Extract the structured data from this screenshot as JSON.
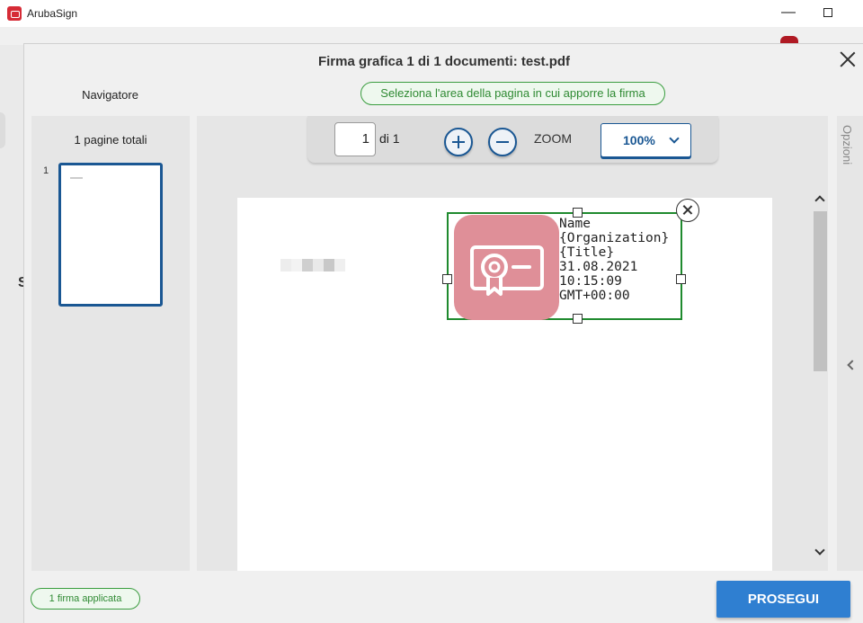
{
  "app": {
    "title": "ArubaSign"
  },
  "dialog": {
    "title": "Firma grafica 1 di 1 documenti: test.pdf",
    "hint": "Seleziona l'area della pagina in cui apporre la firma"
  },
  "navigator": {
    "title": "Navigatore",
    "total_pages": "1 pagine totali",
    "thumbnails": [
      {
        "number": "1"
      }
    ]
  },
  "toolbar": {
    "page_value": "1",
    "page_of": "di 1",
    "zoom_label": "ZOOM",
    "zoom_value": "100%"
  },
  "signature": {
    "text": "Name\n{Organization}\n{Title}\n31.08.2021\n10:15:09\nGMT+00:00",
    "icon_bg": "#df8f98",
    "border_color": "#1f8a2e"
  },
  "options": {
    "label": "Opzioni"
  },
  "footer": {
    "applied": "1 firma applicata",
    "proceed": "PROSEGUI"
  },
  "colors": {
    "primary": "#2f7fd1",
    "nav_blue": "#1a5793",
    "success": "#2f8a33"
  }
}
